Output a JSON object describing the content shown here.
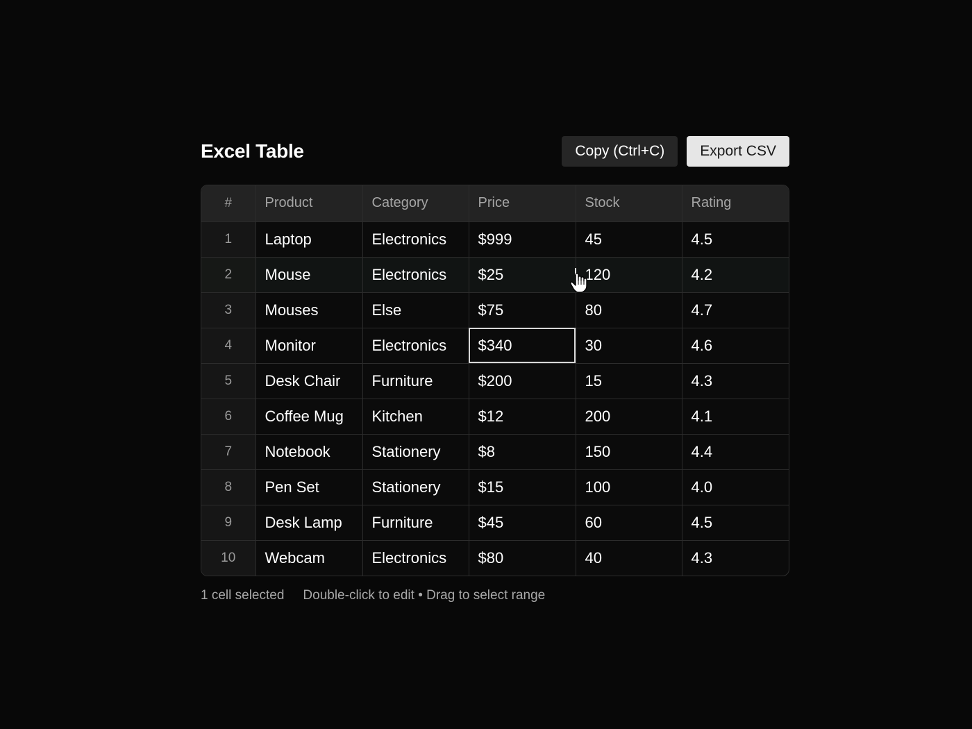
{
  "page": {
    "title": "Excel Table"
  },
  "toolbar": {
    "copy_label": "Copy (Ctrl+C)",
    "export_label": "Export CSV"
  },
  "table": {
    "columns": [
      "#",
      "Product",
      "Category",
      "Price",
      "Stock",
      "Rating"
    ],
    "rows": [
      [
        "1",
        "Laptop",
        "Electronics",
        "$999",
        "45",
        "4.5"
      ],
      [
        "2",
        "Mouse",
        "Electronics",
        "$25",
        "120",
        "4.2"
      ],
      [
        "3",
        "Mouses",
        "Else",
        "$75",
        "80",
        "4.7"
      ],
      [
        "4",
        "Monitor",
        "Electronics",
        "$340",
        "30",
        "4.6"
      ],
      [
        "5",
        "Desk Chair",
        "Furniture",
        "$200",
        "15",
        "4.3"
      ],
      [
        "6",
        "Coffee Mug",
        "Kitchen",
        "$12",
        "200",
        "4.1"
      ],
      [
        "7",
        "Notebook",
        "Stationery",
        "$8",
        "150",
        "4.4"
      ],
      [
        "8",
        "Pen Set",
        "Stationery",
        "$15",
        "100",
        "4.0"
      ],
      [
        "9",
        "Desk Lamp",
        "Furniture",
        "$45",
        "60",
        "4.5"
      ],
      [
        "10",
        "Webcam",
        "Electronics",
        "$80",
        "40",
        "4.3"
      ]
    ],
    "selected_cell": {
      "row": 3,
      "col": 3
    },
    "hover_row": 1
  },
  "footer": {
    "selection_status": "1 cell selected",
    "hint": "Double-click to edit • Drag to select range"
  },
  "icons": {
    "cursor": "hand-pointer-icon"
  },
  "colors": {
    "background": "#080808",
    "header_bg": "#232323",
    "button_dark": "#262626",
    "button_light": "#e6e6e6",
    "selection_outline": "#d8d8d8"
  }
}
